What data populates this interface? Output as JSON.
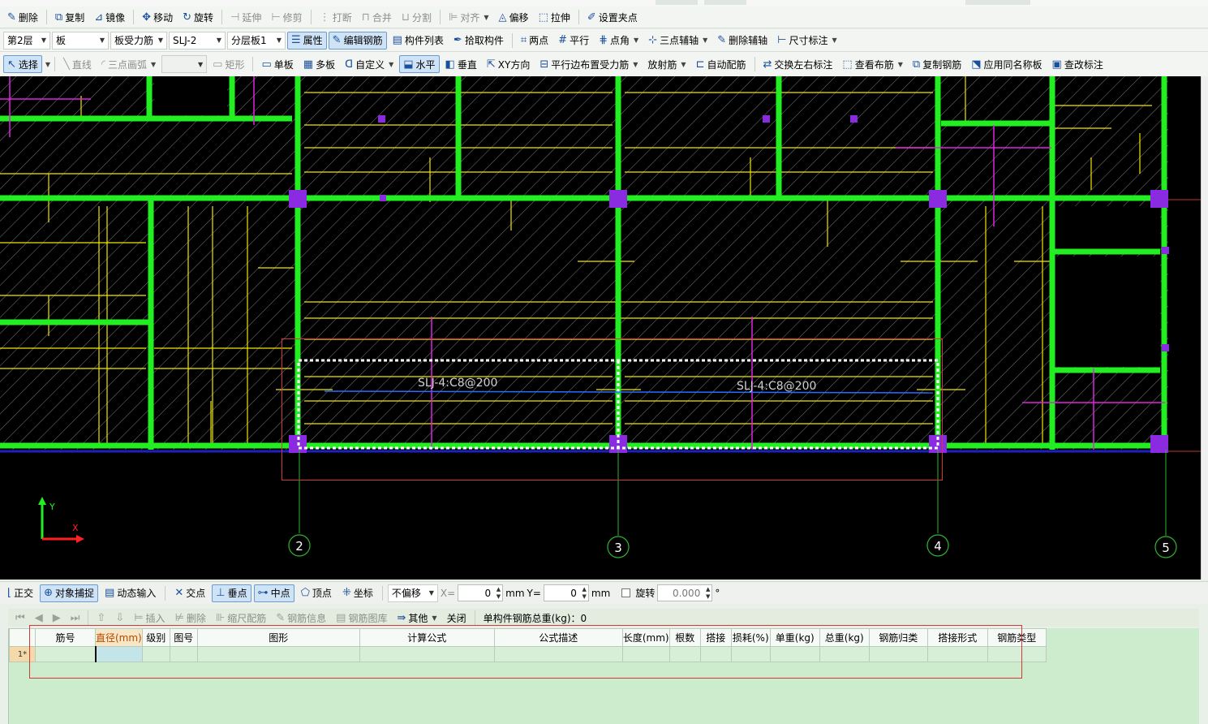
{
  "toolbar1": {
    "delete": "删除",
    "copy": "复制",
    "mirror": "镜像",
    "move": "移动",
    "rotate": "旋转",
    "extend": "延伸",
    "trim": "修剪",
    "break": "打断",
    "merge": "合并",
    "split": "分割",
    "align": "对齐",
    "offset": "偏移",
    "stretch": "拉伸",
    "set_grip": "设置夹点"
  },
  "toolbar2": {
    "floor": "第2层",
    "category": "板",
    "subtype": "板受力筋",
    "name": "SLJ-2",
    "layer": "分层板1",
    "properties": "属性",
    "edit_rebar": "编辑钢筋",
    "component_list": "构件列表",
    "pick_component": "拾取构件",
    "two_points": "两点",
    "parallel": "平行",
    "point_angle": "点角",
    "three_point_axis": "三点辅轴",
    "delete_axis": "删除辅轴",
    "dimension": "尺寸标注"
  },
  "toolbar3": {
    "select": "选择",
    "line": "直线",
    "three_point_arc": "三点画弧",
    "rectangle": "矩形",
    "single_slab": "单板",
    "multi_slab": "多板",
    "custom": "自定义",
    "horizontal": "水平",
    "vertical": "垂直",
    "xy_direction": "XY方向",
    "parallel_edge": "平行边布置受力筋",
    "radial": "放射筋",
    "auto_rebar": "自动配筋",
    "swap_label": "交换左右标注",
    "view_layout": "查看布筋",
    "copy_rebar": "复制钢筋",
    "apply_same_slab": "应用同名称板",
    "check_label": "查改标注"
  },
  "canvas": {
    "label_1": "SLJ-4:C8@200",
    "label_2": "SLJ-4:C8@200",
    "axes": [
      "2",
      "3",
      "4",
      "5"
    ],
    "ucs_y": "Y",
    "ucs_x": "X",
    "colors": {
      "background": "#000000",
      "beam": "#22ee22",
      "rebar": "#f2e600",
      "selected": "#ffffff",
      "column": "#8a2be2",
      "axis": "#2fb52f"
    }
  },
  "snapbar": {
    "ortho": "正交",
    "object_snap": "对象捕捉",
    "dynamic_input": "动态输入",
    "intersection": "交点",
    "perpendicular": "垂点",
    "midpoint": "中点",
    "vertex": "顶点",
    "coordinate": "坐标",
    "offset_mode": "不偏移",
    "x_label": "X=",
    "x_value": "0",
    "y_label": "Y=",
    "y_value": "0",
    "mm1": "mm",
    "mm2": "mm",
    "rotate": "旋转",
    "rotate_value": "0.000",
    "degree": "°"
  },
  "rebar_toolbar": {
    "insert": "插入",
    "delete": "删除",
    "scale_rebar": "缩尺配筋",
    "rebar_info": "钢筋信息",
    "rebar_library": "钢筋图库",
    "other": "其他",
    "close": "关闭",
    "total_weight": "单构件钢筋总重(kg)：0"
  },
  "rebar_table": {
    "headers": [
      "筋号",
      "直径(mm)",
      "级别",
      "图号",
      "图形",
      "计算公式",
      "公式描述",
      "长度(mm)",
      "根数",
      "搭接",
      "损耗(%)",
      "单重(kg)",
      "总重(kg)",
      "钢筋归类",
      "搭接形式",
      "钢筋类型"
    ],
    "row_label": "1*"
  }
}
